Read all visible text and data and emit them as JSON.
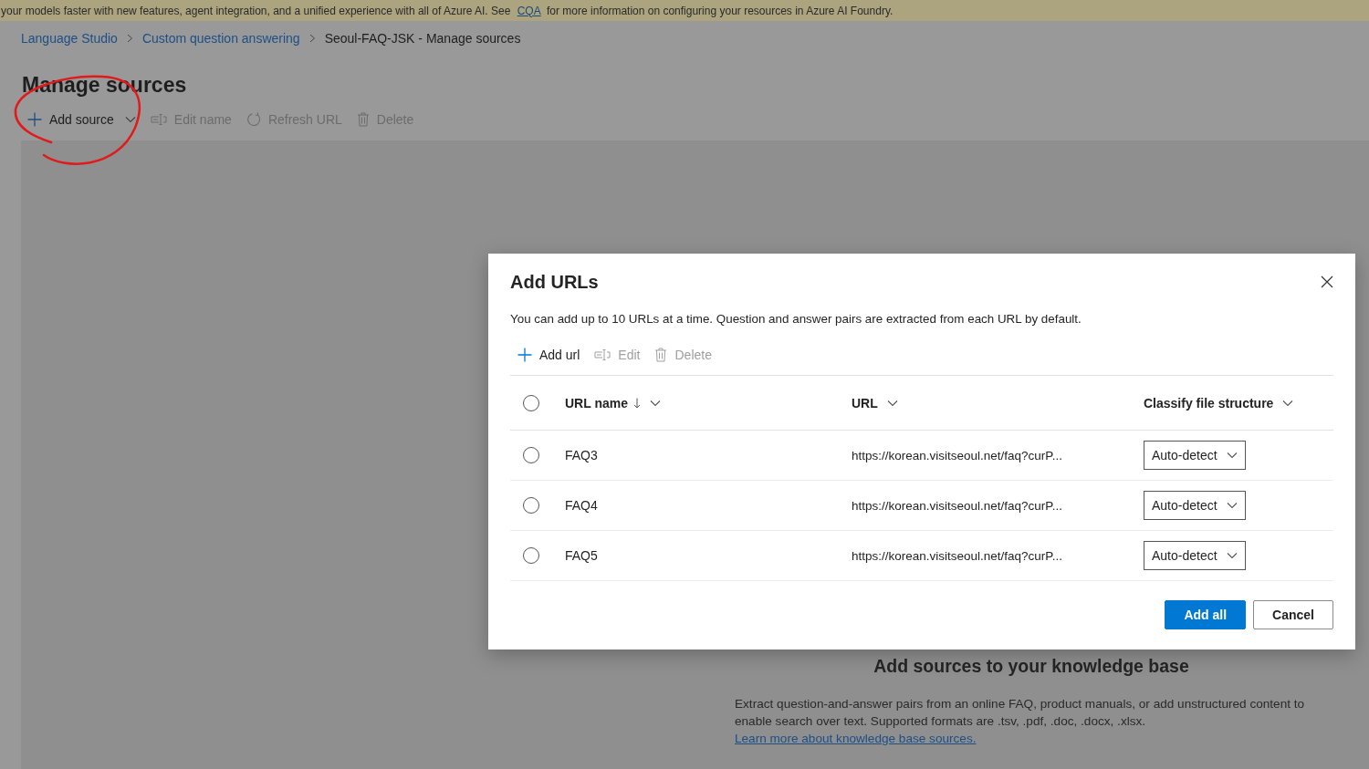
{
  "banner": {
    "text_before": "your models faster with new features, agent integration, and a unified experience with all of Azure AI. See",
    "link": "CQA",
    "text_after": "for more information on configuring your resources in Azure AI Foundry."
  },
  "breadcrumb": [
    {
      "label": "Language Studio",
      "kind": "link"
    },
    {
      "label": "Custom question answering",
      "kind": "link"
    },
    {
      "label": "Seoul-FAQ-JSK - Manage sources",
      "kind": "current"
    }
  ],
  "page_title": "Manage sources",
  "toolbar": [
    {
      "label": "Add source",
      "kind": "plus",
      "disabled": false,
      "menu": true
    },
    {
      "label": "Edit name",
      "kind": "rename",
      "disabled": true,
      "menu": false
    },
    {
      "label": "Refresh URL",
      "kind": "refresh",
      "disabled": true,
      "menu": false
    },
    {
      "label": "Delete",
      "kind": "trash",
      "disabled": true,
      "menu": false
    }
  ],
  "empty_state": {
    "title": "Add sources to your knowledge base",
    "text": "Extract question-and-answer pairs from an online FAQ, product manuals, or add unstructured content to enable search over text. Supported formats are .tsv, .pdf, .doc, .docx, .xlsx.",
    "link": "Learn more about knowledge base sources."
  },
  "dialog": {
    "title": "Add URLs",
    "description": "You can add up to 10 URLs at a time. Question and answer pairs are extracted from each URL by default.",
    "toolbar": [
      {
        "label": "Add url",
        "kind": "plus",
        "disabled": false
      },
      {
        "label": "Edit",
        "kind": "rename",
        "disabled": true
      },
      {
        "label": "Delete",
        "kind": "trash",
        "disabled": true
      }
    ],
    "table": {
      "select_all": {
        "selected": false
      },
      "columns": [
        {
          "label": "URL name",
          "sorted": true
        },
        {
          "label": "URL",
          "sorted": false
        },
        {
          "label": "Classify file structure",
          "sorted": false
        }
      ],
      "rows": [
        {
          "selected": false,
          "name": "FAQ3",
          "url": "https://korean.visitseoul.net/faq?curP...",
          "structure": "Auto-detect"
        },
        {
          "selected": false,
          "name": "FAQ4",
          "url": "https://korean.visitseoul.net/faq?curP...",
          "structure": "Auto-detect"
        },
        {
          "selected": false,
          "name": "FAQ5",
          "url": "https://korean.visitseoul.net/faq?curP...",
          "structure": "Auto-detect"
        }
      ]
    },
    "buttons": [
      {
        "label": "Add all",
        "kind": "primary"
      },
      {
        "label": "Cancel",
        "kind": "secondary"
      }
    ]
  }
}
